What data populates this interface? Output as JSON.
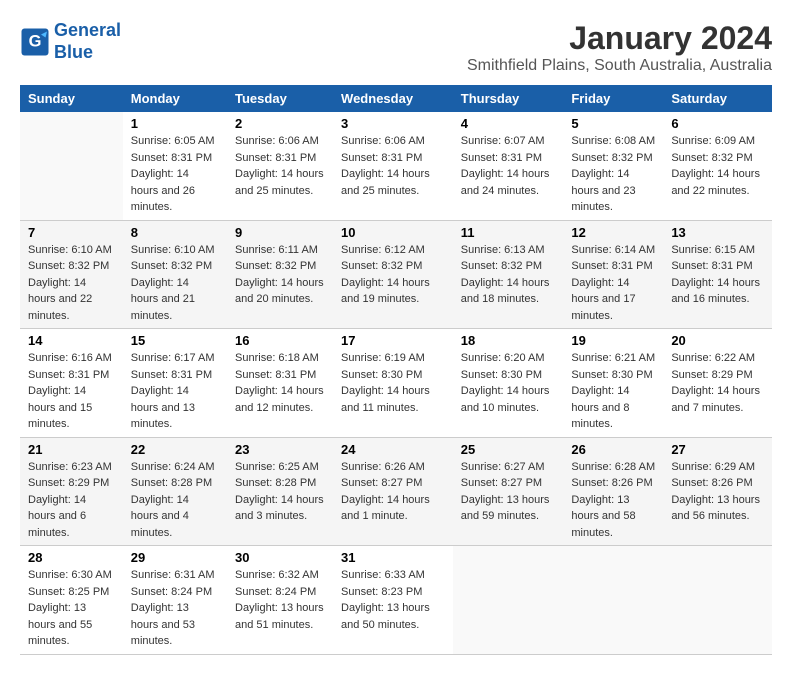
{
  "logo": {
    "line1": "General",
    "line2": "Blue"
  },
  "title": "January 2024",
  "subtitle": "Smithfield Plains, South Australia, Australia",
  "days_of_week": [
    "Sunday",
    "Monday",
    "Tuesday",
    "Wednesday",
    "Thursday",
    "Friday",
    "Saturday"
  ],
  "weeks": [
    [
      {
        "day": "",
        "sunrise": "",
        "sunset": "",
        "daylight": ""
      },
      {
        "day": "1",
        "sunrise": "Sunrise: 6:05 AM",
        "sunset": "Sunset: 8:31 PM",
        "daylight": "Daylight: 14 hours and 26 minutes."
      },
      {
        "day": "2",
        "sunrise": "Sunrise: 6:06 AM",
        "sunset": "Sunset: 8:31 PM",
        "daylight": "Daylight: 14 hours and 25 minutes."
      },
      {
        "day": "3",
        "sunrise": "Sunrise: 6:06 AM",
        "sunset": "Sunset: 8:31 PM",
        "daylight": "Daylight: 14 hours and 25 minutes."
      },
      {
        "day": "4",
        "sunrise": "Sunrise: 6:07 AM",
        "sunset": "Sunset: 8:31 PM",
        "daylight": "Daylight: 14 hours and 24 minutes."
      },
      {
        "day": "5",
        "sunrise": "Sunrise: 6:08 AM",
        "sunset": "Sunset: 8:32 PM",
        "daylight": "Daylight: 14 hours and 23 minutes."
      },
      {
        "day": "6",
        "sunrise": "Sunrise: 6:09 AM",
        "sunset": "Sunset: 8:32 PM",
        "daylight": "Daylight: 14 hours and 22 minutes."
      }
    ],
    [
      {
        "day": "7",
        "sunrise": "Sunrise: 6:10 AM",
        "sunset": "Sunset: 8:32 PM",
        "daylight": "Daylight: 14 hours and 22 minutes."
      },
      {
        "day": "8",
        "sunrise": "Sunrise: 6:10 AM",
        "sunset": "Sunset: 8:32 PM",
        "daylight": "Daylight: 14 hours and 21 minutes."
      },
      {
        "day": "9",
        "sunrise": "Sunrise: 6:11 AM",
        "sunset": "Sunset: 8:32 PM",
        "daylight": "Daylight: 14 hours and 20 minutes."
      },
      {
        "day": "10",
        "sunrise": "Sunrise: 6:12 AM",
        "sunset": "Sunset: 8:32 PM",
        "daylight": "Daylight: 14 hours and 19 minutes."
      },
      {
        "day": "11",
        "sunrise": "Sunrise: 6:13 AM",
        "sunset": "Sunset: 8:32 PM",
        "daylight": "Daylight: 14 hours and 18 minutes."
      },
      {
        "day": "12",
        "sunrise": "Sunrise: 6:14 AM",
        "sunset": "Sunset: 8:31 PM",
        "daylight": "Daylight: 14 hours and 17 minutes."
      },
      {
        "day": "13",
        "sunrise": "Sunrise: 6:15 AM",
        "sunset": "Sunset: 8:31 PM",
        "daylight": "Daylight: 14 hours and 16 minutes."
      }
    ],
    [
      {
        "day": "14",
        "sunrise": "Sunrise: 6:16 AM",
        "sunset": "Sunset: 8:31 PM",
        "daylight": "Daylight: 14 hours and 15 minutes."
      },
      {
        "day": "15",
        "sunrise": "Sunrise: 6:17 AM",
        "sunset": "Sunset: 8:31 PM",
        "daylight": "Daylight: 14 hours and 13 minutes."
      },
      {
        "day": "16",
        "sunrise": "Sunrise: 6:18 AM",
        "sunset": "Sunset: 8:31 PM",
        "daylight": "Daylight: 14 hours and 12 minutes."
      },
      {
        "day": "17",
        "sunrise": "Sunrise: 6:19 AM",
        "sunset": "Sunset: 8:30 PM",
        "daylight": "Daylight: 14 hours and 11 minutes."
      },
      {
        "day": "18",
        "sunrise": "Sunrise: 6:20 AM",
        "sunset": "Sunset: 8:30 PM",
        "daylight": "Daylight: 14 hours and 10 minutes."
      },
      {
        "day": "19",
        "sunrise": "Sunrise: 6:21 AM",
        "sunset": "Sunset: 8:30 PM",
        "daylight": "Daylight: 14 hours and 8 minutes."
      },
      {
        "day": "20",
        "sunrise": "Sunrise: 6:22 AM",
        "sunset": "Sunset: 8:29 PM",
        "daylight": "Daylight: 14 hours and 7 minutes."
      }
    ],
    [
      {
        "day": "21",
        "sunrise": "Sunrise: 6:23 AM",
        "sunset": "Sunset: 8:29 PM",
        "daylight": "Daylight: 14 hours and 6 minutes."
      },
      {
        "day": "22",
        "sunrise": "Sunrise: 6:24 AM",
        "sunset": "Sunset: 8:28 PM",
        "daylight": "Daylight: 14 hours and 4 minutes."
      },
      {
        "day": "23",
        "sunrise": "Sunrise: 6:25 AM",
        "sunset": "Sunset: 8:28 PM",
        "daylight": "Daylight: 14 hours and 3 minutes."
      },
      {
        "day": "24",
        "sunrise": "Sunrise: 6:26 AM",
        "sunset": "Sunset: 8:27 PM",
        "daylight": "Daylight: 14 hours and 1 minute."
      },
      {
        "day": "25",
        "sunrise": "Sunrise: 6:27 AM",
        "sunset": "Sunset: 8:27 PM",
        "daylight": "Daylight: 13 hours and 59 minutes."
      },
      {
        "day": "26",
        "sunrise": "Sunrise: 6:28 AM",
        "sunset": "Sunset: 8:26 PM",
        "daylight": "Daylight: 13 hours and 58 minutes."
      },
      {
        "day": "27",
        "sunrise": "Sunrise: 6:29 AM",
        "sunset": "Sunset: 8:26 PM",
        "daylight": "Daylight: 13 hours and 56 minutes."
      }
    ],
    [
      {
        "day": "28",
        "sunrise": "Sunrise: 6:30 AM",
        "sunset": "Sunset: 8:25 PM",
        "daylight": "Daylight: 13 hours and 55 minutes."
      },
      {
        "day": "29",
        "sunrise": "Sunrise: 6:31 AM",
        "sunset": "Sunset: 8:24 PM",
        "daylight": "Daylight: 13 hours and 53 minutes."
      },
      {
        "day": "30",
        "sunrise": "Sunrise: 6:32 AM",
        "sunset": "Sunset: 8:24 PM",
        "daylight": "Daylight: 13 hours and 51 minutes."
      },
      {
        "day": "31",
        "sunrise": "Sunrise: 6:33 AM",
        "sunset": "Sunset: 8:23 PM",
        "daylight": "Daylight: 13 hours and 50 minutes."
      },
      {
        "day": "",
        "sunrise": "",
        "sunset": "",
        "daylight": ""
      },
      {
        "day": "",
        "sunrise": "",
        "sunset": "",
        "daylight": ""
      },
      {
        "day": "",
        "sunrise": "",
        "sunset": "",
        "daylight": ""
      }
    ]
  ]
}
